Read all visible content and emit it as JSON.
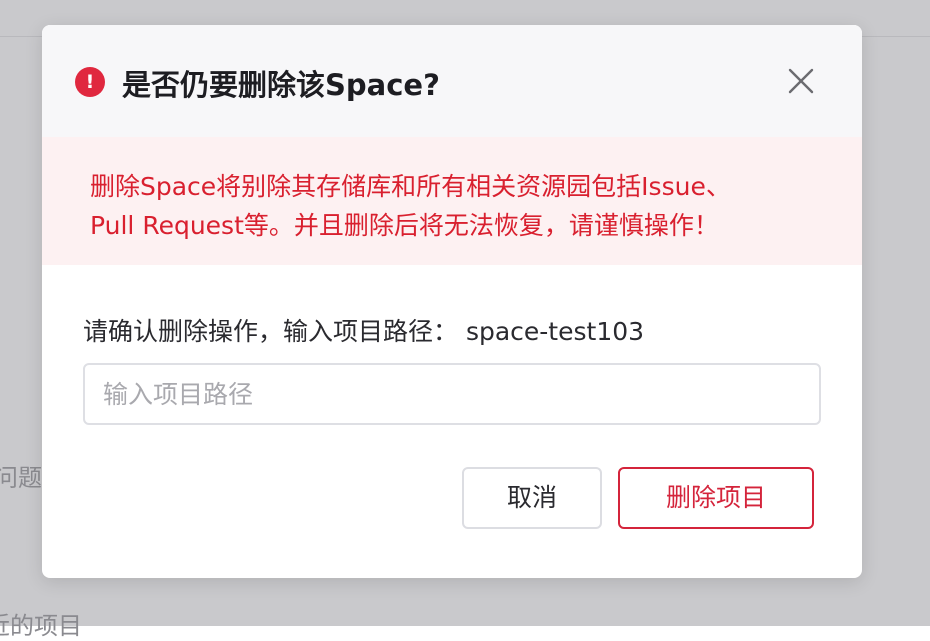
{
  "background": {
    "fragment_1": "问题",
    "fragment_2": "近的项目"
  },
  "dialog": {
    "title": "是否仍要删除该Space?",
    "alert_icon_glyph": "!",
    "warning_lines": [
      "删除Space将别除其存储库和所有相关资源园包括Issue、",
      "Pull Request等。并且删除后将无法恢复，请谨慎操作！"
    ],
    "confirm_prompt": "请确认删除操作，输入项目路径：  space-test103",
    "input": {
      "value": "",
      "placeholder": "输入项目路径"
    },
    "cancel_label": "取消",
    "delete_label": "删除项目"
  },
  "colors": {
    "danger": "#d4243b",
    "warning_bg": "#fdf1f2",
    "header_bg": "#f7f7f9"
  },
  "icons": {
    "alert": "alert-circle-icon",
    "close": "close-icon"
  }
}
